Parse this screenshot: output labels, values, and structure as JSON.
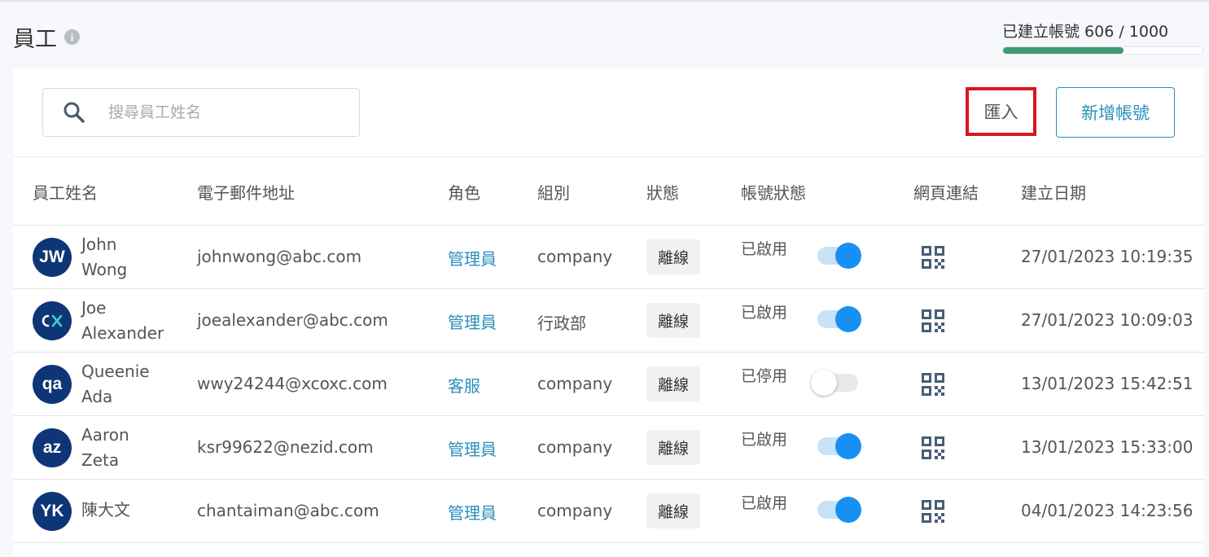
{
  "header": {
    "title": "員工",
    "quota_text": "已建立帳號 606 / 1000",
    "quota_used": 606,
    "quota_total": 1000
  },
  "toolbar": {
    "search_placeholder": "搜尋員工姓名",
    "import_label": "匯入",
    "add_label": "新增帳號"
  },
  "table": {
    "columns": [
      "員工姓名",
      "電子郵件地址",
      "角色",
      "組別",
      "狀態",
      "帳號狀態",
      "網頁連結",
      "建立日期"
    ],
    "rows": [
      {
        "avatar": "JW",
        "avatar_style": "text",
        "name_line1": "John",
        "name_line2": "Wong",
        "email": "johnwong@abc.com",
        "role": "管理員",
        "group": "company",
        "status": "離線",
        "account_status": "已啟用",
        "enabled": true,
        "created": "27/01/2023 10:19:35"
      },
      {
        "avatar": "cx",
        "avatar_style": "logo",
        "name_line1": "Joe",
        "name_line2": "Alexander",
        "email": "joealexander@abc.com",
        "role": "管理員",
        "group": "行政部",
        "status": "離線",
        "account_status": "已啟用",
        "enabled": true,
        "created": "27/01/2023 10:09:03"
      },
      {
        "avatar": "qa",
        "avatar_style": "text",
        "name_line1": "Queenie",
        "name_line2": "Ada",
        "email": "wwy24244@xcoxc.com",
        "role": "客服",
        "group": "company",
        "status": "離線",
        "account_status": "已停用",
        "enabled": false,
        "created": "13/01/2023 15:42:51"
      },
      {
        "avatar": "az",
        "avatar_style": "text",
        "name_line1": "Aaron",
        "name_line2": "Zeta",
        "email": "ksr99622@nezid.com",
        "role": "管理員",
        "group": "company",
        "status": "離線",
        "account_status": "已啟用",
        "enabled": true,
        "created": "13/01/2023 15:33:00"
      },
      {
        "avatar": "YK",
        "avatar_style": "text",
        "name_line1": "陳大文",
        "name_line2": "",
        "email": "chantaiman@abc.com",
        "role": "管理員",
        "group": "company",
        "status": "離線",
        "account_status": "已啟用",
        "enabled": true,
        "created": "04/01/2023 14:23:56"
      }
    ]
  },
  "colors": {
    "accent": "#2a8fbd",
    "toggle_on": "#1890f3",
    "quota_fill": "#3d9b6f",
    "avatar_bg": "#0e3677",
    "highlight_border": "#d9161f"
  },
  "icons": {
    "search": "search-icon",
    "info": "info-icon",
    "qr": "qr-code-icon"
  }
}
